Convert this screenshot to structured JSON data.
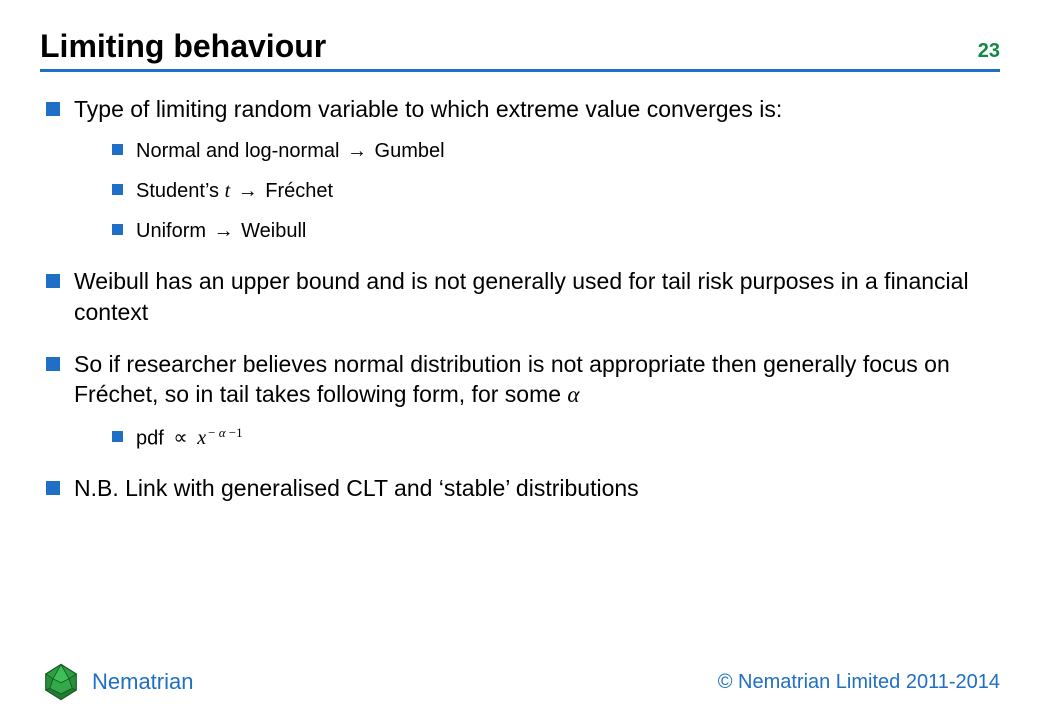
{
  "header": {
    "title": "Limiting behaviour",
    "page_number": "23"
  },
  "symbols": {
    "arrow": "→",
    "propto": "∝",
    "alpha": "α",
    "t": "t",
    "x": "x"
  },
  "bullets": [
    {
      "text": "Type of limiting random variable to which extreme value converges is:",
      "sub": [
        {
          "pre": "Normal and log-normal ",
          "post": " Gumbel",
          "arrow": true
        },
        {
          "pre": "Student’s ",
          "mathi": "t",
          "mid": " ",
          "post": " Fréchet",
          "arrow": true
        },
        {
          "pre": "Uniform ",
          "post": " Weibull",
          "arrow": true
        }
      ]
    },
    {
      "text": "Weibull has an upper bound and is not generally used for tail risk purposes in a financial context"
    },
    {
      "text_pre": "So if researcher believes normal distribution is not appropriate then generally focus on Fréchet, so in tail takes following form, for some ",
      "text_mathi": "α",
      "sub": [
        {
          "pdf": true,
          "label": "pdf "
        }
      ]
    },
    {
      "text": "N.B. Link with generalised CLT and ‘stable’ distributions"
    }
  ],
  "pdf_formula": {
    "base": "x",
    "exp_prefix": "− ",
    "exp_alpha": "α",
    "exp_suffix": " −1"
  },
  "footer": {
    "brand_name": "Nematrian",
    "copyright": "© Nematrian Limited 2011-2014"
  }
}
